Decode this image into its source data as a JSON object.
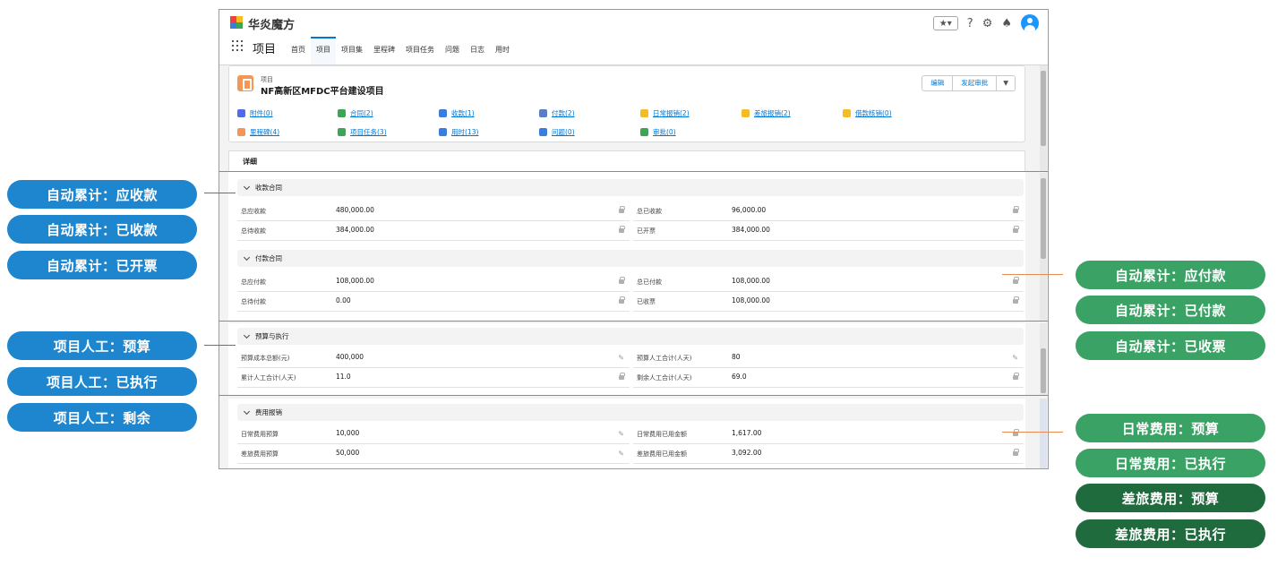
{
  "app": {
    "brand": "华炎魔方",
    "name": "项目"
  },
  "nav": [
    "首页",
    "项目",
    "项目集",
    "里程碑",
    "项目任务",
    "问题",
    "日志",
    "用时"
  ],
  "nav_active": 1,
  "header_icons": [
    "star-icon",
    "help-icon",
    "gear-icon",
    "bell-icon",
    "avatar-icon"
  ],
  "record": {
    "type": "项目",
    "title": "NF高新区MFDC平台建设项目",
    "buttons": {
      "edit": "编辑",
      "approve": "发起审批"
    }
  },
  "related": [
    {
      "label": "附件(0)",
      "color": "#4f6bed"
    },
    {
      "label": "合同(2)",
      "color": "#3ba755"
    },
    {
      "label": "收款(1)",
      "color": "#3b7ddd"
    },
    {
      "label": "付款(2)",
      "color": "#5a7ec5"
    },
    {
      "label": "日常报销(2)",
      "color": "#f4bc25"
    },
    {
      "label": "差旅报销(2)",
      "color": "#f4bc25"
    },
    {
      "label": "借款核销(0)",
      "color": "#f4bc25"
    },
    {
      "label": "里程碑(4)",
      "color": "#f49756"
    },
    {
      "label": "项目任务(3)",
      "color": "#3ba755"
    },
    {
      "label": "用时(13)",
      "color": "#3b7ddd"
    },
    {
      "label": "问题(0)",
      "color": "#3b7ddd"
    },
    {
      "label": "审批(0)",
      "color": "#3ba755"
    }
  ],
  "tab": "详细",
  "sections": {
    "receipt": {
      "title": "收款合同",
      "fields": [
        {
          "label": "总应收款",
          "value": "480,000.00"
        },
        {
          "label": "总已收款",
          "value": "96,000.00"
        },
        {
          "label": "总待收款",
          "value": "384,000.00"
        },
        {
          "label": "已开票",
          "value": "384,000.00"
        }
      ]
    },
    "payment": {
      "title": "付款合同",
      "fields": [
        {
          "label": "总应付款",
          "value": "108,000.00"
        },
        {
          "label": "总已付款",
          "value": "108,000.00"
        },
        {
          "label": "总待付款",
          "value": "0.00"
        },
        {
          "label": "已收票",
          "value": "108,000.00"
        }
      ]
    },
    "budget": {
      "title": "预算与执行",
      "fields": [
        {
          "label": "预算成本总额(元)",
          "value": "400,000"
        },
        {
          "label": "预算人工合计(人天)",
          "value": "80"
        },
        {
          "label": "累计人工合计(人天)",
          "value": "11.0"
        },
        {
          "label": "剩余人工合计(人天)",
          "value": "69.0"
        }
      ]
    },
    "expense": {
      "title": "费用报销",
      "fields": [
        {
          "label": "日常费用预算",
          "value": "10,000"
        },
        {
          "label": "日常费用已用金额",
          "value": "1,617.00"
        },
        {
          "label": "差旅费用预算",
          "value": "50,000"
        },
        {
          "label": "差旅费用已用金额",
          "value": "3,092.00"
        }
      ]
    }
  },
  "callouts": {
    "left": [
      "自动累计：应收款",
      "自动累计：已收款",
      "自动累计：已开票",
      "项目人工：预算",
      "项目人工：已执行",
      "项目人工：剩余"
    ],
    "right": [
      "自动累计：应付款",
      "自动累计：已付款",
      "自动累计：已收票",
      "日常费用：预算",
      "日常费用：已执行",
      "差旅费用：预算",
      "差旅费用：已执行"
    ]
  },
  "colors": {
    "accent": "#0176d3",
    "callout_blue": "#1e86cf",
    "callout_green": "#3aa264",
    "callout_dark_green": "#1f6b3d"
  }
}
